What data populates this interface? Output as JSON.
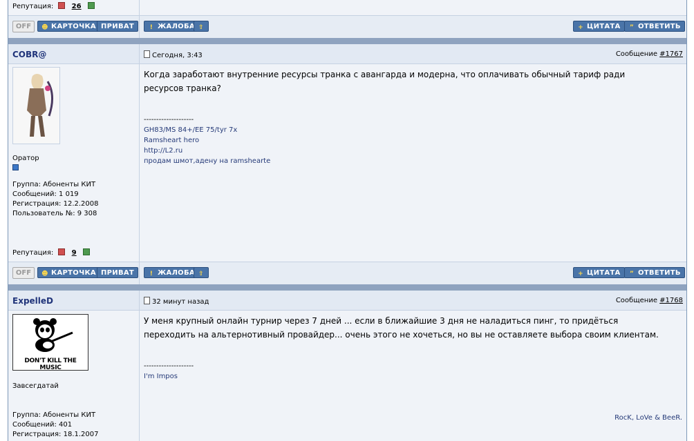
{
  "top": {
    "reputation_label": "Репутация:",
    "reputation_value": "26"
  },
  "buttons": {
    "off": "OFF",
    "card": "КАРТОЧКА",
    "private": "ПРИВАТ",
    "report": "ЖАЛОБА",
    "quote": "ЦИТАТА",
    "reply": "ОТВЕТИТЬ"
  },
  "posts": [
    {
      "username": "COBR@",
      "time": "Сегодня, 3:43",
      "msg_label": "Сообщение",
      "msg_num": "#1767",
      "rank": "Оратор",
      "group": "Группа: Абоненты КИТ",
      "messages": "Сообщений: 1 019",
      "registration": "Регистрация: 12.2.2008",
      "user_no": "Пользователь №: 9 308",
      "reputation_label": "Репутация:",
      "reputation_value": "9",
      "text_line1": "Когда заработают внутренние ресурсы транка с авангарда и модерна, что оплачивать обычный тариф ради",
      "text_line2": "ресурсов транка?",
      "sig_divider": "--------------------",
      "sig_lines": [
        "GH83/MS 84+/EE 75/tyr 7x",
        "Ramsheart hero",
        "http://L2.ru",
        "продам шмот,адену на ramshearte"
      ]
    },
    {
      "username": "ExpelleD",
      "time": "32 минут назад",
      "msg_label": "Сообщение",
      "msg_num": "#1768",
      "avatar_text": "DON'T KILL THE MUSIC",
      "rank": "Завсегдатай",
      "group": "Группа: Абоненты КИТ",
      "messages": "Сообщений: 401",
      "registration": "Регистрация: 18.1.2007",
      "text_line1": "У меня крупный онлайн турнир через 7 дней ... если в ближайшие 3 дня не наладиться пинг, то придёться",
      "text_line2": "переходить на альтернотивный провайдер... очень этого не хочеться, но вы не оставляете выбора своим клиентам.",
      "sig_divider": "--------------------",
      "sig_lines": [
        "I'm Impos"
      ],
      "sig_right": "RocK, LoVe & BeeR."
    }
  ],
  "colors": {
    "button_blue": "#4a74a8",
    "separator": "#8fa3bf",
    "username": "#20347a",
    "signature": "#253a78"
  }
}
